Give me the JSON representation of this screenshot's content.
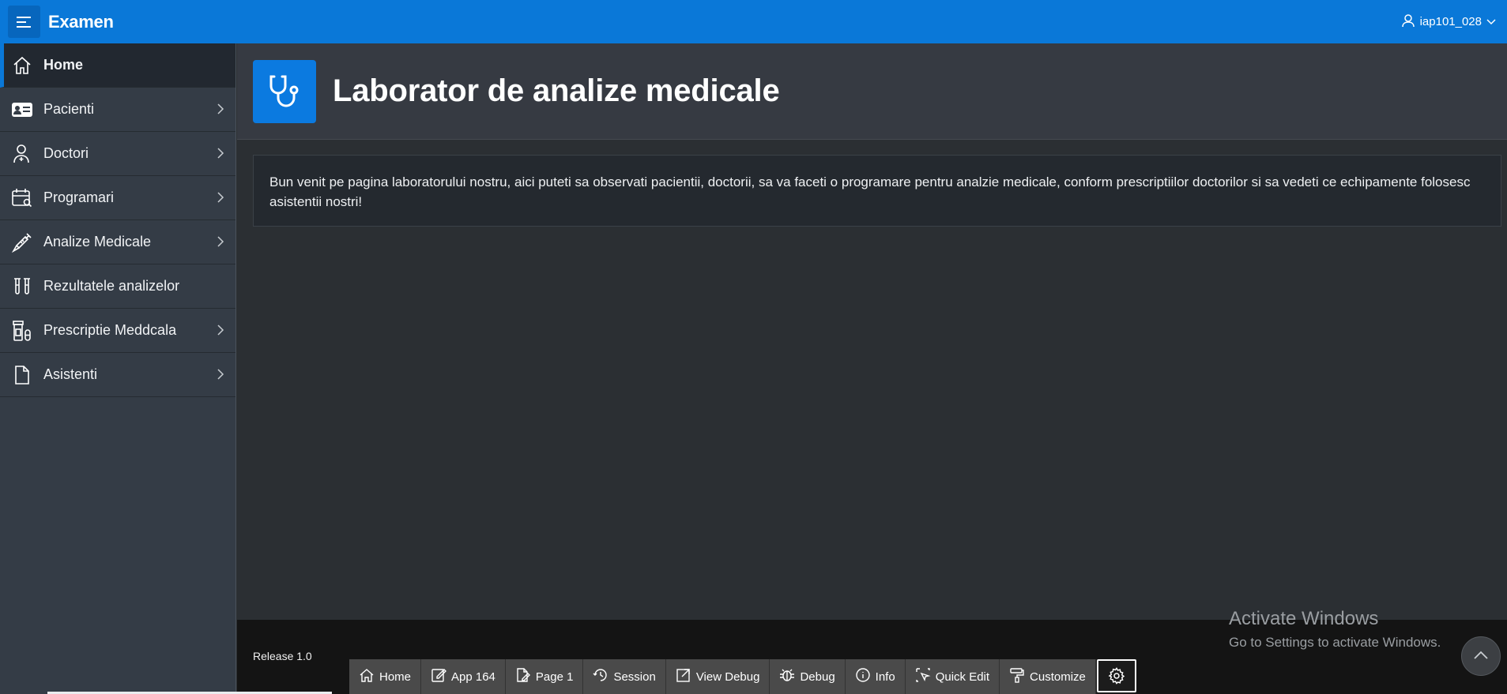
{
  "header": {
    "app_title": "Examen",
    "menu_icon": "hamburger-menu-icon",
    "user_name": "iap101_028",
    "user_icon": "user-icon"
  },
  "sidebar": {
    "items": [
      {
        "label": "Home",
        "icon": "home-icon",
        "active": true,
        "has_children": false
      },
      {
        "label": "Pacienti",
        "icon": "id-card-icon",
        "active": false,
        "has_children": true
      },
      {
        "label": "Doctori",
        "icon": "user-medical-icon",
        "active": false,
        "has_children": true
      },
      {
        "label": "Programari",
        "icon": "calendar-search-icon",
        "active": false,
        "has_children": true
      },
      {
        "label": "Analize Medicale",
        "icon": "syringe-icon",
        "active": false,
        "has_children": true
      },
      {
        "label": "Rezultatele analizelor",
        "icon": "test-tubes-icon",
        "active": false,
        "has_children": false
      },
      {
        "label": "Prescriptie Meddcala",
        "icon": "pill-bottle-icon",
        "active": false,
        "has_children": true
      },
      {
        "label": "Asistenti",
        "icon": "file-icon",
        "active": false,
        "has_children": true
      }
    ]
  },
  "main": {
    "hero_icon": "stethoscope-icon",
    "title": "Laborator de analize medicale",
    "welcome_text": "Bun venit pe pagina laboratorului nostru, aici puteti sa observati pacientii, doctorii, sa va faceti o programare pentru analzie medicale, conform prescriptiilor doctorilor si sa vedeti ce echipamente folosesc asistentii nostri!"
  },
  "footer": {
    "release": "Release 1.0",
    "dev_toolbar": [
      {
        "label": "Home",
        "icon": "home-icon"
      },
      {
        "label": "App 164",
        "icon": "edit-icon"
      },
      {
        "label": "Page 1",
        "icon": "page-edit-icon"
      },
      {
        "label": "Session",
        "icon": "session-icon"
      },
      {
        "label": "View Debug",
        "icon": "external-link-icon"
      },
      {
        "label": "Debug",
        "icon": "bug-icon"
      },
      {
        "label": "Info",
        "icon": "info-icon"
      },
      {
        "label": "Quick Edit",
        "icon": "cursor-select-icon"
      },
      {
        "label": "Customize",
        "icon": "paint-roller-icon"
      }
    ],
    "settings_icon": "gear-icon"
  },
  "watermark": {
    "title": "Activate Windows",
    "subtitle": "Go to Settings to activate Windows."
  },
  "colors": {
    "header_bg": "#0a78d8",
    "sidebar_bg": "#343c46",
    "main_bg": "#2b2f33",
    "accent": "#0b7ae0"
  }
}
